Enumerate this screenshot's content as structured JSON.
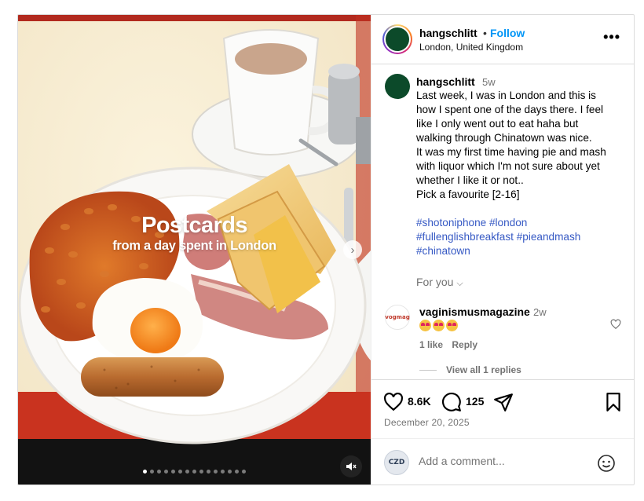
{
  "media": {
    "overlay_title": "Postcards",
    "overlay_subtitle": "from a day spent in London",
    "slide_count": 15,
    "active_slide": 1
  },
  "header": {
    "username": "hangschlitt",
    "separator": "•",
    "follow_label": "Follow",
    "location": "London, United Kingdom",
    "more_label": "•••"
  },
  "caption": {
    "username": "hangschlitt",
    "time": "5w",
    "lines": [
      "Last week, I was in London and this is",
      "how I spent one of the days there. I feel",
      "like I only went out to eat haha but",
      "walking through Chinatown was nice.",
      "It was my first time having pie and mash",
      "with liquor which I'm not sure about yet",
      "whether I like it or not..",
      "Pick a favourite [2-16]"
    ],
    "hashtags_line1": "#shotoniphone #london",
    "hashtags_line2": "#fullenglishbreakfast #pieandmash",
    "hashtags_line3": "#chinatown",
    "for_you_label": "For you"
  },
  "comment": {
    "avatar_text": "vogmag",
    "username": "vaginismusmagazine",
    "time": "2w",
    "likes_label": "1 like",
    "reply_label": "Reply",
    "view_replies_label": "View all 1 replies"
  },
  "actions": {
    "likes_count": "8.6K",
    "comments_count": "125",
    "date": "December 20, 2025"
  },
  "add_comment": {
    "avatar_text": "CZD",
    "placeholder": "Add a comment..."
  },
  "colors": {
    "link_blue": "#0095f6",
    "hashtag_blue": "#3659c4",
    "muted_gray": "#737373",
    "border": "#dbdbdb"
  }
}
